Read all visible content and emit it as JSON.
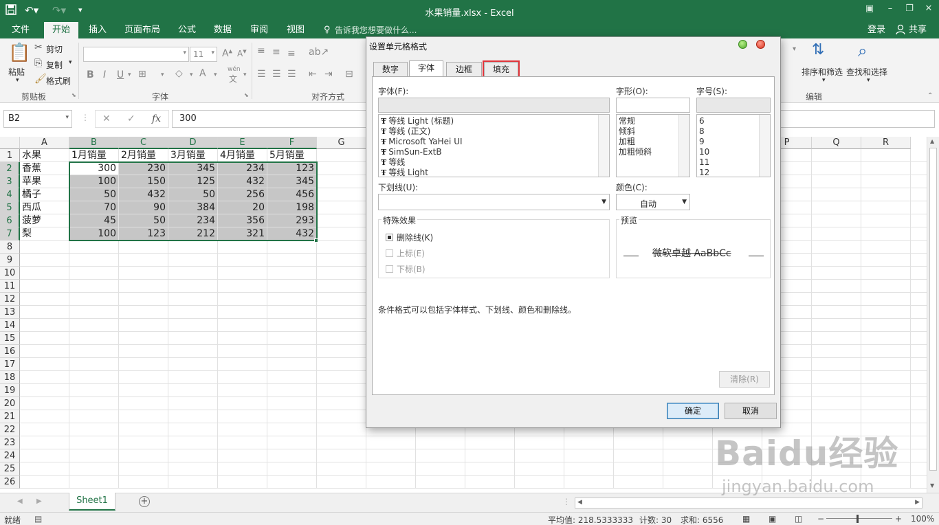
{
  "titlebar": {
    "title": "水果销量.xlsx - Excel"
  },
  "ribbon_tabs": [
    {
      "label": "文件"
    },
    {
      "label": "开始"
    },
    {
      "label": "插入"
    },
    {
      "label": "页面布局"
    },
    {
      "label": "公式"
    },
    {
      "label": "数据"
    },
    {
      "label": "审阅"
    },
    {
      "label": "视图"
    }
  ],
  "tell_me": "告诉我您想要做什么...",
  "account": {
    "signin": "登录",
    "share": "共享"
  },
  "ribbon": {
    "clipboard": {
      "paste": "粘贴",
      "cut": "剪切",
      "copy": "复制",
      "format_painter": "格式刷",
      "group": "剪贴板"
    },
    "font": {
      "size": "11",
      "group": "字体",
      "wen": "wén",
      "wen_char": "文"
    },
    "align": {
      "group": "对齐方式"
    },
    "edit": {
      "sort_filter": "排序和筛选",
      "find_select": "查找和选择",
      "group": "编辑"
    }
  },
  "formula": {
    "name_box": "B2",
    "value": "300",
    "fx": "fx"
  },
  "columns": [
    "A",
    "B",
    "C",
    "D",
    "E",
    "F",
    "G",
    "P",
    "Q",
    "R"
  ],
  "rows": [
    "1",
    "2",
    "3",
    "4",
    "5",
    "6",
    "7",
    "8",
    "9",
    "10",
    "11",
    "12",
    "13",
    "14",
    "15",
    "16",
    "17",
    "18",
    "19",
    "20",
    "21",
    "22",
    "23",
    "24",
    "25",
    "26"
  ],
  "sheet": {
    "headers": [
      "水果",
      "1月销量",
      "2月销量",
      "3月销量",
      "4月销量",
      "5月销量"
    ],
    "data": [
      [
        "香蕉",
        "300",
        "230",
        "345",
        "234",
        "123"
      ],
      [
        "苹果",
        "100",
        "150",
        "125",
        "432",
        "345"
      ],
      [
        "橘子",
        "50",
        "432",
        "50",
        "256",
        "456"
      ],
      [
        "西瓜",
        "70",
        "90",
        "384",
        "20",
        "198"
      ],
      [
        "菠萝",
        "45",
        "50",
        "234",
        "356",
        "293"
      ],
      [
        "梨",
        "100",
        "123",
        "212",
        "321",
        "432"
      ]
    ]
  },
  "sheet_tabs": [
    {
      "label": "Sheet1"
    }
  ],
  "status": {
    "ready": "就绪",
    "average": "平均值: 218.5333333",
    "count": "计数: 30",
    "sum": "求和: 6556",
    "zoom": "100%"
  },
  "dialog": {
    "title": "设置单元格格式",
    "tabs": [
      "数字",
      "字体",
      "边框",
      "填充"
    ],
    "font_label": "字体(F):",
    "font_items": [
      "等线 Light (标题)",
      "等线 (正文)",
      "Microsoft YaHei UI",
      "SimSun-ExtB",
      "等线",
      "等线 Light"
    ],
    "style_label": "字形(O):",
    "style_items": [
      "常规",
      "倾斜",
      "加粗",
      "加粗倾斜"
    ],
    "size_label": "字号(S):",
    "size_items": [
      "6",
      "8",
      "9",
      "10",
      "11",
      "12"
    ],
    "underline_label": "下划线(U):",
    "underline_value": "",
    "color_label": "颜色(C):",
    "color_value": "自动",
    "effects_title": "特殊效果",
    "effects": [
      {
        "label": "删除线(K)",
        "checked": true,
        "enabled": true
      },
      {
        "label": "上标(E)",
        "checked": false,
        "enabled": false
      },
      {
        "label": "下标(B)",
        "checked": false,
        "enabled": false
      }
    ],
    "preview_title": "预览",
    "preview_text": "微软卓越  AaBbCc",
    "note": "条件格式可以包括字体样式、下划线、颜色和删除线。",
    "clear_label": "清除(R)",
    "ok_label": "确定",
    "cancel_label": "取消",
    "icon_tt": "Ŧ"
  },
  "watermark": {
    "line1": "Baidu经验",
    "line2": "jingyan.baidu.com"
  },
  "colors": {
    "excel_green": "#217346",
    "highlight_red": "#e0343a"
  }
}
